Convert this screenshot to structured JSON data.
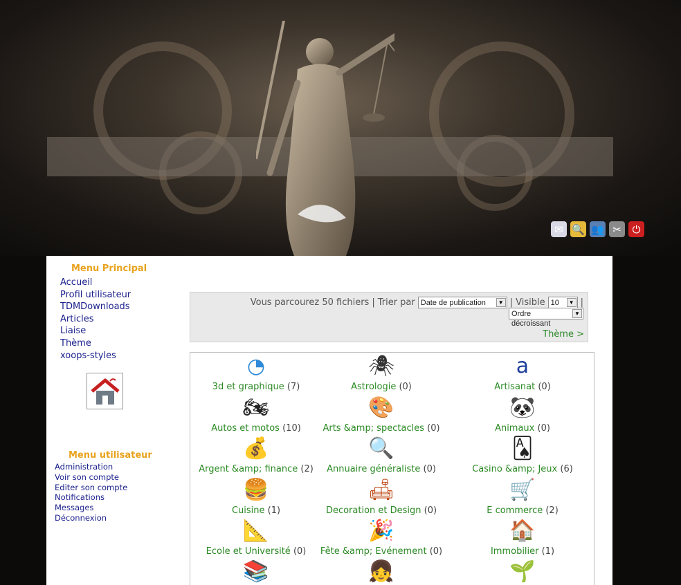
{
  "colors": {
    "menu_title": "#e8a31e",
    "menu_link": "#1a1f8c",
    "category_link": "#2b8a24",
    "sort_bar_bg": "#e9e9e9"
  },
  "header": {
    "user_icons": [
      {
        "icon": "mail-icon",
        "color": "#d9d9e6",
        "glyph": "✉"
      },
      {
        "icon": "search-icon",
        "color": "#e5b93a",
        "glyph": "🔍"
      },
      {
        "icon": "profile-icon",
        "color": "#5a7fb3",
        "glyph": "👥"
      },
      {
        "icon": "tools-icon",
        "color": "#8a8a8a",
        "glyph": "✂"
      },
      {
        "icon": "power-icon",
        "color": "#cc1f1f",
        "glyph": "⏻"
      }
    ]
  },
  "sidebar": {
    "main_menu_title": "Menu Principal",
    "main_menu": [
      "Accueil",
      "Profil utilisateur",
      "TDMDownloads",
      "Articles",
      "Liaise",
      "Thème",
      "xoops-styles"
    ],
    "home_image_icon": "house-icon",
    "user_menu_title": "Menu utilisateur",
    "user_menu": [
      "Administration",
      "Voir son compte",
      "Editer son compte",
      "Notifications",
      "Messages",
      "Déconnexion"
    ]
  },
  "sort_bar": {
    "browsing_text": "Vous parcourez 50 fichiers",
    "sort_label": "Trier par",
    "sort_value": "Date de publication",
    "visible_label": "Visible",
    "visible_value": "10",
    "order_value": "Ordre décroissant",
    "theme_link": "Thème >"
  },
  "categories": [
    {
      "name": "3d et graphique",
      "count": "(7)",
      "icon": "pie-chart-icon",
      "glyph": "◔",
      "color": "#2e8ad8"
    },
    {
      "name": "Astrologie",
      "count": "(0)",
      "icon": "spider-icon",
      "glyph": "🕷",
      "color": "#333"
    },
    {
      "name": "Artisanat",
      "count": "(0)",
      "icon": "logo-a-icon",
      "glyph": "a",
      "color": "#1f3f9c"
    },
    {
      "name": "Autos et motos",
      "count": "(10)",
      "icon": "motorbike-icon",
      "glyph": "🏍",
      "color": "#222"
    },
    {
      "name": "Arts &amp; spectacles",
      "count": "(0)",
      "icon": "palette-icon",
      "glyph": "🎨",
      "color": "#b5742a"
    },
    {
      "name": "Animaux",
      "count": "(0)",
      "icon": "panda-icon",
      "glyph": "🐼",
      "color": "#111"
    },
    {
      "name": "Argent &amp; finance",
      "count": "(2)",
      "icon": "money-icon",
      "glyph": "💰",
      "color": "#d9a82a"
    },
    {
      "name": "Annuaire généraliste",
      "count": "(0)",
      "icon": "magnifier-icon",
      "glyph": "🔍",
      "color": "#3a6db3"
    },
    {
      "name": "Casino &amp; Jeux",
      "count": "(6)",
      "icon": "playing-cards-icon",
      "glyph": "🂡",
      "color": "#222"
    },
    {
      "name": "Cuisine",
      "count": "(1)",
      "icon": "burger-icon",
      "glyph": "🍔",
      "color": "#b56a1f"
    },
    {
      "name": "Decoration et Design",
      "count": "(0)",
      "icon": "sofa-icon",
      "glyph": "🛋",
      "color": "#c2501f"
    },
    {
      "name": "E commerce",
      "count": "(2)",
      "icon": "shopping-cart-icon",
      "glyph": "🛒",
      "color": "#777"
    },
    {
      "name": "Ecole et Université",
      "count": "(0)",
      "icon": "compass-ruler-icon",
      "glyph": "📐",
      "color": "#555"
    },
    {
      "name": "Fête &amp; Evénement",
      "count": "(0)",
      "icon": "party-hat-icon",
      "glyph": "🎉",
      "color": "#d9a82a"
    },
    {
      "name": "Immobilier",
      "count": "(1)",
      "icon": "house-icon",
      "glyph": "🏠",
      "color": "#8a6a3a"
    },
    {
      "name": "",
      "count": "",
      "icon": "books-icon",
      "glyph": "📚",
      "color": "#2e6ab3"
    },
    {
      "name": "",
      "count": "",
      "icon": "girl-icon",
      "glyph": "👧",
      "color": "#b5742a"
    },
    {
      "name": "",
      "count": "",
      "icon": "boot-plant-icon",
      "glyph": "🌱",
      "color": "#6a5a2a"
    }
  ]
}
